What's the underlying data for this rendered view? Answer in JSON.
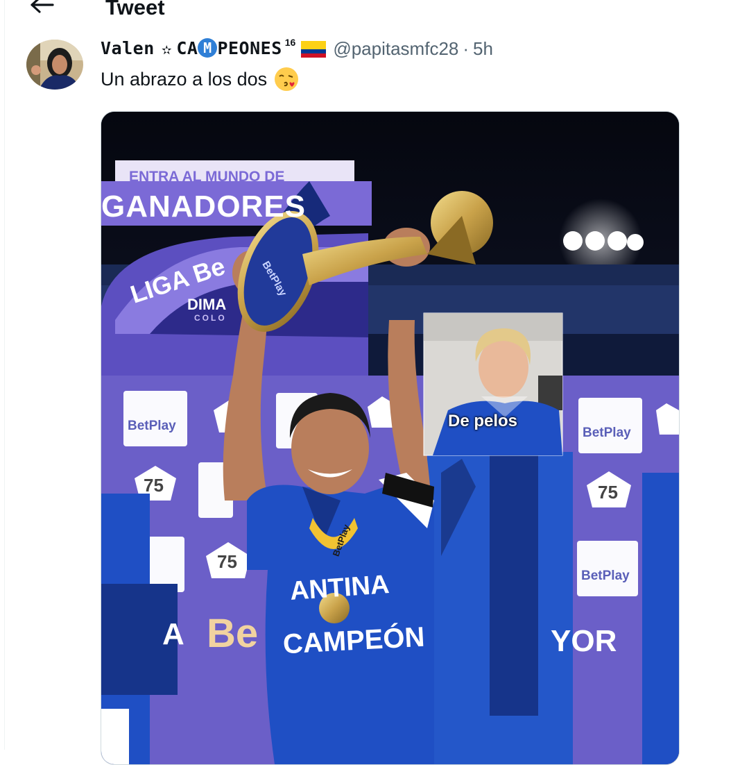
{
  "header": {
    "back_icon": "arrow-left-icon",
    "title": "Tweet"
  },
  "tweet": {
    "avatar_alt": "avatar",
    "display_name_prefix": "Valen",
    "display_name_star": "✫",
    "display_name_ca": "CA",
    "display_name_m": "M",
    "display_name_rest": "PEONES",
    "display_name_sup": "16",
    "flag_icon": "colombia-flag-icon",
    "handle": "@papitasmfc28",
    "separator": "·",
    "time": "5h",
    "text": "Un abrazo a los dos",
    "emoji_icon": "face-blowing-kiss-icon"
  },
  "media": {
    "banner_top": "ENTRA AL MUNDO DE",
    "banner_main": "GANADORES",
    "liga": "LIGA Be",
    "dimayor": "DIMA",
    "dimayor_sub": "COLO",
    "sponsor": "BetPlay",
    "anniversary": "75",
    "trophy_text": "BetPlay",
    "jersey_club": "ANTINA",
    "jersey_word": "CAMPEÓN",
    "medal_ribbon": "BetPlay",
    "bottom_left": "A",
    "bottom_mid": "Be",
    "bottom_right": "YOR",
    "inset_caption": "De pelos",
    "colors": {
      "backdrop": "#6b5fc8",
      "jersey": "#1f4fc4",
      "gold": "#c9a24a"
    }
  }
}
